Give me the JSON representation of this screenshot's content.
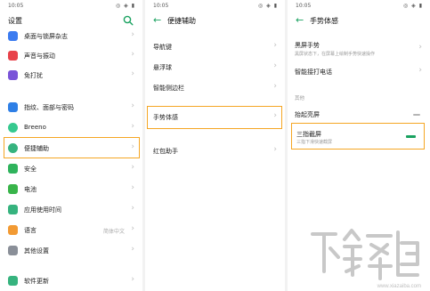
{
  "colors": {
    "accent": "#1aa260",
    "highlight": "#f5a623"
  },
  "status_bar": {
    "time": "10:05",
    "icons": "◎ ◈ ▮"
  },
  "panel1": {
    "title": "设置",
    "items": [
      {
        "label": "桌面与锁屏杂志",
        "icon": "desktop-icon",
        "color": "#3b7bf0"
      },
      {
        "label": "声音与振动",
        "icon": "sound-icon",
        "color": "#e8424a"
      },
      {
        "label": "免打扰",
        "icon": "moon-icon",
        "color": "#7a54d8"
      },
      {
        "label": "指纹、面部与密码",
        "icon": "fingerprint-icon",
        "color": "#2e7fe6"
      },
      {
        "label": "Breeno",
        "icon": "breeno-icon",
        "color": "#36c98f"
      },
      {
        "label": "便捷辅助",
        "icon": "assist-icon",
        "color": "#36b37e"
      },
      {
        "label": "安全",
        "icon": "shield-icon",
        "color": "#2fb35c"
      },
      {
        "label": "电池",
        "icon": "battery-icon",
        "color": "#38b44a"
      },
      {
        "label": "应用使用时间",
        "icon": "hourglass-icon",
        "color": "#36b37e"
      },
      {
        "label": "语言",
        "value": "简体中文",
        "icon": "language-icon",
        "color": "#f29a33"
      },
      {
        "label": "其他设置",
        "icon": "more-settings-icon",
        "color": "#8a8f98"
      },
      {
        "label": "软件更新",
        "icon": "update-icon",
        "color": "#36b37e"
      }
    ]
  },
  "panel2": {
    "title": "便捷辅助",
    "items": [
      {
        "label": "导航键"
      },
      {
        "label": "悬浮球"
      },
      {
        "label": "智能侧边栏"
      },
      {
        "label": "手势体感"
      },
      {
        "label": "红包助手"
      }
    ]
  },
  "panel3": {
    "title": "手势体感",
    "items": [
      {
        "label": "黑屏手势",
        "sub": "黑屏状态下，在屏幕上绘制手势快速操作"
      },
      {
        "label": "智能接打电话"
      }
    ],
    "section": "其他",
    "raise_label": "抬起亮屏",
    "screenshot_label": "三指截屏",
    "screenshot_sub": "三指下滑快速截屏"
  },
  "watermark": {
    "url": "www.xiazaiba.com"
  }
}
